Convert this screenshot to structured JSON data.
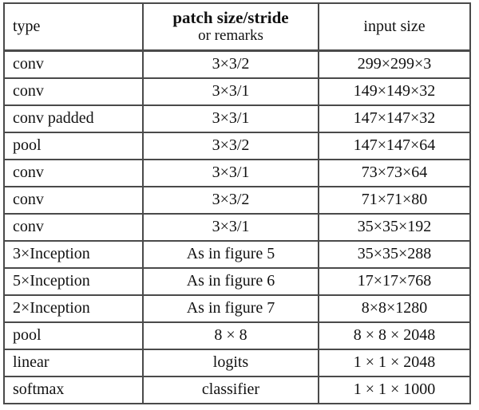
{
  "table": {
    "caption_present": false,
    "headers": {
      "type": "type",
      "patch_main": "patch size/stride",
      "patch_sub": "or remarks",
      "input": "input size"
    },
    "columns": [
      "type",
      "patch size/stride or remarks",
      "input size"
    ],
    "rows": [
      {
        "type": "conv",
        "patch": "3×3/2",
        "input": "299×299×3"
      },
      {
        "type": "conv",
        "patch": "3×3/1",
        "input": "149×149×32"
      },
      {
        "type": "conv padded",
        "patch": "3×3/1",
        "input": "147×147×32"
      },
      {
        "type": "pool",
        "patch": "3×3/2",
        "input": "147×147×64"
      },
      {
        "type": "conv",
        "patch": "3×3/1",
        "input": "73×73×64"
      },
      {
        "type": "conv",
        "patch": "3×3/2",
        "input": "71×71×80"
      },
      {
        "type": "conv",
        "patch": "3×3/1",
        "input": "35×35×192"
      },
      {
        "type": "3×Inception",
        "patch": "As in figure 5",
        "input": "35×35×288"
      },
      {
        "type": "5×Inception",
        "patch": "As in figure 6",
        "input": "17×17×768"
      },
      {
        "type": "2×Inception",
        "patch": "As in figure 7",
        "input": "8×8×1280"
      },
      {
        "type": "pool",
        "patch": "8 × 8",
        "input": "8 × 8 × 2048"
      },
      {
        "type": "linear",
        "patch": "logits",
        "input": "1 × 1 × 2048"
      },
      {
        "type": "softmax",
        "patch": "classifier",
        "input": "1 × 1 × 1000"
      }
    ],
    "colors": {
      "border": "#4a4a4a",
      "text": "#111111",
      "background": "#ffffff"
    }
  }
}
